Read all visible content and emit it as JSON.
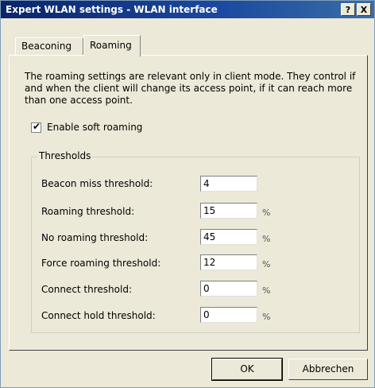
{
  "window": {
    "title": "Expert WLAN settings - WLAN interface",
    "help_label": "?",
    "close_label": "X"
  },
  "tabs": [
    {
      "label": "Beaconing"
    },
    {
      "label": "Roaming"
    }
  ],
  "description": "The roaming settings are relevant only in client mode. They control if and when the client will change its access point, if it can reach more than one access point.",
  "soft_roaming": {
    "label": "Enable soft roaming",
    "checked": true,
    "mark": "✔"
  },
  "thresholds": {
    "group_label": "Thresholds",
    "rows": [
      {
        "label": "Beacon miss threshold:",
        "value": "4",
        "unit": ""
      },
      {
        "label": "Roaming threshold:",
        "value": "15",
        "unit": "%"
      },
      {
        "label": "No roaming threshold:",
        "value": "45",
        "unit": "%"
      },
      {
        "label": "Force roaming threshold:",
        "value": "12",
        "unit": "%"
      },
      {
        "label": "Connect threshold:",
        "value": "0",
        "unit": "%"
      },
      {
        "label": "Connect hold threshold:",
        "value": "0",
        "unit": "%"
      }
    ]
  },
  "buttons": {
    "ok": "OK",
    "cancel": "Abbrechen"
  }
}
